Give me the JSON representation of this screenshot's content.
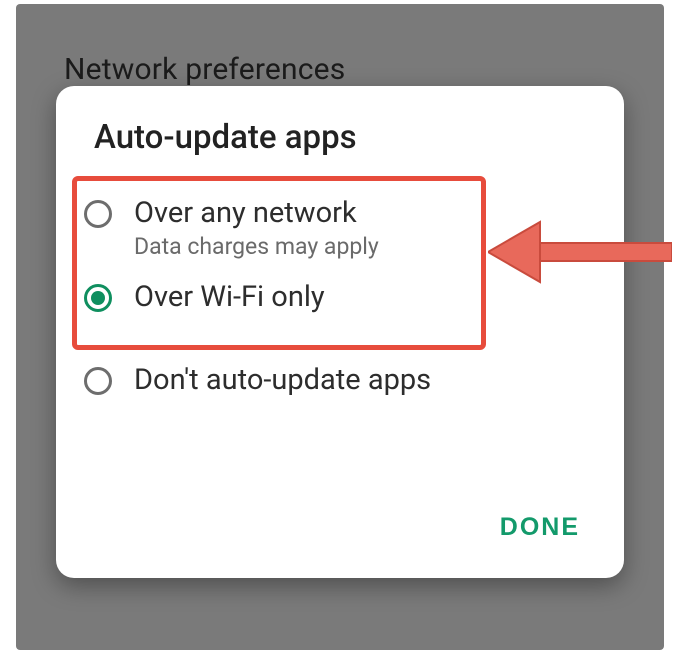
{
  "background": {
    "page_title": "Network preferences"
  },
  "dialog": {
    "title": "Auto-update apps",
    "options": [
      {
        "label": "Over any network",
        "sublabel": "Data charges may apply",
        "selected": false
      },
      {
        "label": "Over Wi-Fi only",
        "sublabel": "",
        "selected": true
      },
      {
        "label": "Don't auto-update apps",
        "sublabel": "",
        "selected": false
      }
    ],
    "done_label": "DONE"
  },
  "annotations": {
    "highlight": "first-two-options",
    "arrow_color": "#e8695b"
  }
}
